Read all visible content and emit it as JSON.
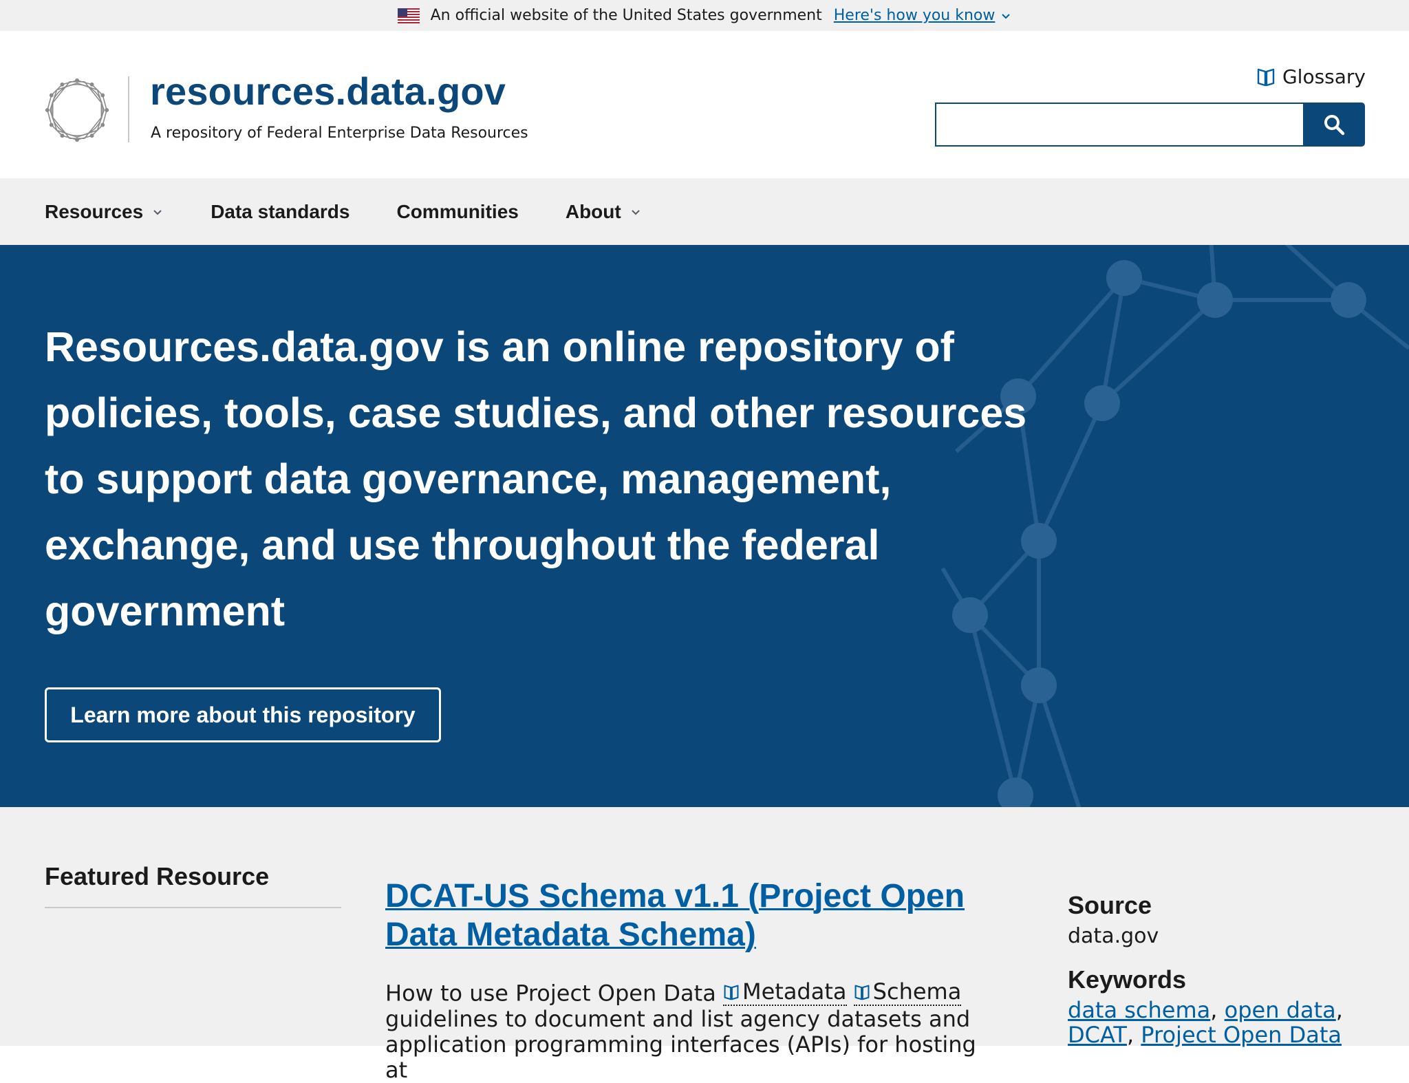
{
  "banner": {
    "official_text": "An official website of the United States government",
    "how_link": "Here's how you know"
  },
  "header": {
    "site_title": "resources.data.gov",
    "tagline": "A repository of Federal Enterprise Data Resources",
    "glossary_label": "Glossary",
    "search_value": ""
  },
  "nav": {
    "items": [
      {
        "label": "Resources",
        "has_dropdown": true
      },
      {
        "label": "Data standards",
        "has_dropdown": false
      },
      {
        "label": "Communities",
        "has_dropdown": false
      },
      {
        "label": "About",
        "has_dropdown": true
      }
    ]
  },
  "hero": {
    "text": "Resources.data.gov is an online repository of policies, tools, case studies, and other resources to support data governance, management, exchange, and use throughout the federal government",
    "button_label": "Learn more about this repository"
  },
  "featured": {
    "heading": "Featured Resource",
    "resource_title": "DCAT-US Schema v1.1 (Project Open Data Metadata Schema)",
    "description_parts": {
      "prefix": "How to use Project Open Data ",
      "term1": "Metadata",
      "term2": "Schema",
      "suffix": " guidelines to document and list agency datasets and application programming interfaces (APIs) for hosting at"
    },
    "source_label": "Source",
    "source_value": "data.gov",
    "keywords_label": "Keywords",
    "keywords": [
      "data schema",
      "open data",
      "DCAT",
      "Project Open Data"
    ]
  },
  "colors": {
    "primary_dark": "#0b4778",
    "link": "#005ea2",
    "base_lightest": "#f0f0f0"
  }
}
